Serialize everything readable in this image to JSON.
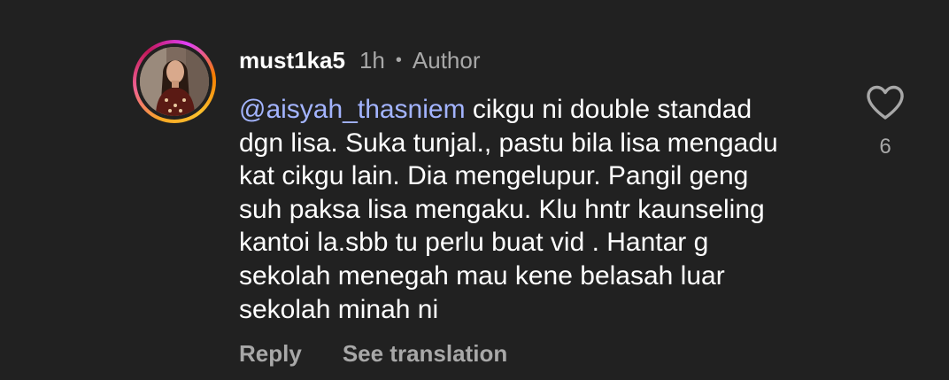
{
  "comment": {
    "username": "must1ka5",
    "time": "1h",
    "separator": "•",
    "author_badge": "Author",
    "mention": "@aisyah_thasniem",
    "lines": [
      " cikgu ni double standad",
      "dgn lisa. Suka tunjal., pastu bila lisa mengadu",
      "kat cikgu lain. Dia mengelupur. Pangil geng",
      "suh paksa lisa mengaku. Klu hntr kaunseling",
      "kantoi la.sbb tu perlu buat vid . Hantar g",
      "sekolah menegah mau kene belasah luar",
      "sekolah minah ni"
    ],
    "actions": {
      "reply": "Reply",
      "see_translation": "See translation"
    },
    "like_count": "6"
  },
  "colors": {
    "background": "#212121",
    "text": "#ffffff",
    "muted": "#a8a8a8",
    "mention": "#a3b4ff"
  },
  "icons": {
    "like": "heart-outline-icon",
    "avatar": "profile-photo"
  }
}
